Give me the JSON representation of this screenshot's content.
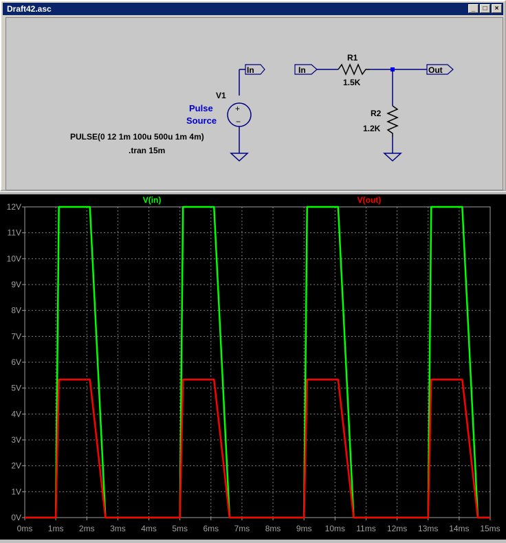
{
  "window": {
    "title": "Draft42.asc",
    "buttons": {
      "minimize": "_",
      "maximize": "□",
      "close": "×"
    }
  },
  "schematic": {
    "v1_name": "V1",
    "v1_desc_line1": "Pulse",
    "v1_desc_line2": "Source",
    "v1_value": "PULSE(0 12 1m 100u 500u 1m 4m)",
    "directive": ".tran 15m",
    "label_in_source": "In",
    "label_in": "In",
    "label_out": "Out",
    "r1_name": "R1",
    "r1_value": "1.5K",
    "r2_name": "R2",
    "r2_value": "1.2K"
  },
  "chart_data": {
    "type": "line",
    "x_unit": "ms",
    "xlim": [
      0,
      15
    ],
    "ylim": [
      0,
      12
    ],
    "x_ticks": [
      "0ms",
      "1ms",
      "2ms",
      "3ms",
      "4ms",
      "5ms",
      "6ms",
      "7ms",
      "8ms",
      "9ms",
      "10ms",
      "11ms",
      "12ms",
      "13ms",
      "14ms",
      "15ms"
    ],
    "y_ticks": [
      "0V",
      "1V",
      "2V",
      "3V",
      "4V",
      "5V",
      "6V",
      "7V",
      "8V",
      "9V",
      "10V",
      "11V",
      "12V"
    ],
    "grid": true,
    "series": [
      {
        "name": "V(in)",
        "color": "#00ff00",
        "x": [
          0,
          1,
          1.1,
          2.1,
          2.6,
          5,
          5.1,
          6.1,
          6.6,
          9,
          9.1,
          10.1,
          10.6,
          13,
          13.1,
          14.1,
          14.6,
          15
        ],
        "y": [
          0,
          0,
          12,
          12,
          0,
          0,
          12,
          12,
          0,
          0,
          12,
          12,
          0,
          0,
          12,
          12,
          0,
          0
        ]
      },
      {
        "name": "V(out)",
        "color": "#ff0000",
        "x": [
          0,
          1,
          1.1,
          2.1,
          2.6,
          5,
          5.1,
          6.1,
          6.6,
          9,
          9.1,
          10.1,
          10.6,
          13,
          13.1,
          14.1,
          14.6,
          15
        ],
        "y": [
          0,
          0,
          5.33,
          5.33,
          0,
          0,
          5.33,
          5.33,
          0,
          0,
          5.33,
          5.33,
          0,
          0,
          5.33,
          5.33,
          0,
          0
        ]
      }
    ]
  }
}
